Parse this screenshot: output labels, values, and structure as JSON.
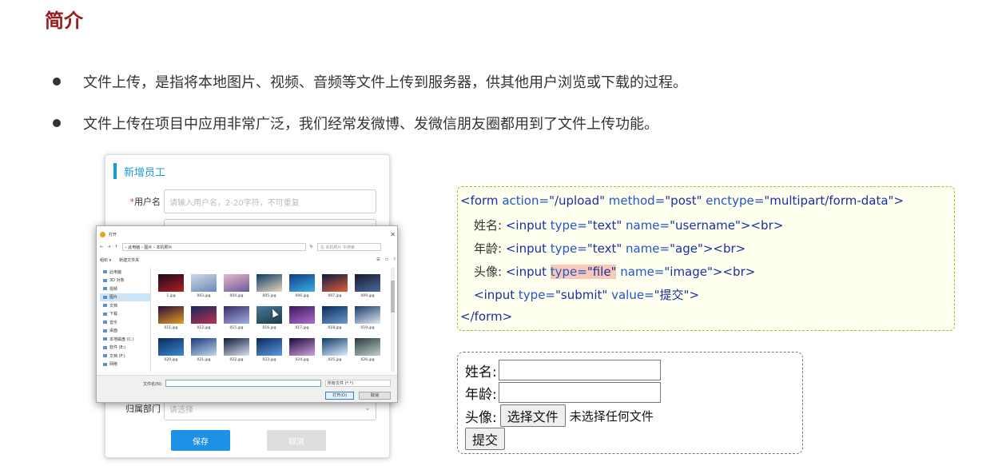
{
  "page": {
    "title": "简介",
    "bullets": [
      "文件上传，是指将本地图片、视频、音频等文件上传到服务器，供其他用户浏览或下载的过程。",
      "文件上传在项目中应用非常广泛，我们经常发微博、发微信朋友圈都用到了文件上传功能。"
    ]
  },
  "employee_form": {
    "heading": "新增员工",
    "username_label": "用户名",
    "username_placeholder": "请输入用户名，2-20字符，不可重复",
    "dept_label": "归属部门",
    "dept_placeholder": "请选择",
    "save_label": "保存",
    "cancel_label": "取消"
  },
  "file_dialog": {
    "title": "打开",
    "path": "› 此电脑 › 图片 › 本机照片",
    "search_placeholder": "在 本机照片 中搜索",
    "organize_label": "组织 ▾",
    "new_folder_label": "新建文件夹",
    "sidebar": [
      "此电脑",
      "3D 对象",
      "视频",
      "图片",
      "文档",
      "下载",
      "音乐",
      "桌面",
      "本地磁盘 (C:)",
      "软件 (E:)",
      "文档 (F:)",
      "网络"
    ],
    "selected_sidebar": "图片",
    "files": [
      "1.jpg",
      "003.jpg",
      "004.jpg",
      "005.jpg",
      "006.jpg",
      "007.jpg",
      "009.jpg",
      "011.jpg",
      "012.jpg",
      "015.jpg",
      "016.jpg",
      "017.jpg",
      "018.jpg",
      "019.jpg",
      "020.jpg",
      "021.jpg",
      "022.jpg",
      "023.jpg",
      "024.jpg",
      "025.jpg",
      "026.jpg"
    ],
    "filename_label": "文件名(N):",
    "filetype_value": "所有文件 (*.*)",
    "open_label": "打开(O)",
    "cancel_label": "取消"
  },
  "code": {
    "line1": [
      "<form ",
      "action=",
      "\"/upload\" ",
      "method=",
      "\"post\" ",
      "enctype=",
      "\"multipart/form-data\"",
      ">"
    ],
    "line2": [
      "姓名: ",
      "<input ",
      "type=",
      "\"text\" ",
      "name=",
      "\"username\"",
      "><br>"
    ],
    "line3": [
      "年龄: ",
      "<input ",
      "type=",
      "\"text\" ",
      "name=",
      "\"age\"",
      "><br>"
    ],
    "line4": [
      "头像: ",
      "<input ",
      "type=",
      "\"file\"",
      " name=",
      "\"image\"",
      "><br>"
    ],
    "line5": [
      "<input ",
      "type=",
      "\"submit\" ",
      "value=",
      "\"提交\"",
      ">"
    ],
    "line6": "</form>"
  },
  "demo_form": {
    "name_label": "姓名:",
    "age_label": "年龄:",
    "avatar_label": "头像:",
    "choose_file_label": "选择文件",
    "no_file_text": "未选择任何文件",
    "submit_label": "提交"
  },
  "colors": {
    "title": "#9b1c1c",
    "accent_blue": "#1b9ad6",
    "code_tag": "#1a2fa0",
    "code_attr": "#2255c9",
    "highlight": "#f8c8b8"
  }
}
